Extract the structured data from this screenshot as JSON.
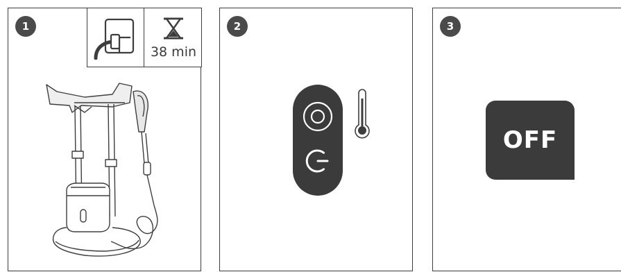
{
  "steps": [
    {
      "number": "1",
      "time_label": "38 min",
      "icons": [
        "power-plug-icon",
        "hourglass-icon"
      ]
    },
    {
      "number": "2",
      "icons": [
        "power-button-icon",
        "temperature-button-icon",
        "thermometer-icon"
      ]
    },
    {
      "number": "3",
      "status_label": "OFF"
    }
  ],
  "colors": {
    "line": "#3d3d3d",
    "fill_dark": "#3b3b3b",
    "badge": "#4a4a4a",
    "background": "#ffffff"
  }
}
